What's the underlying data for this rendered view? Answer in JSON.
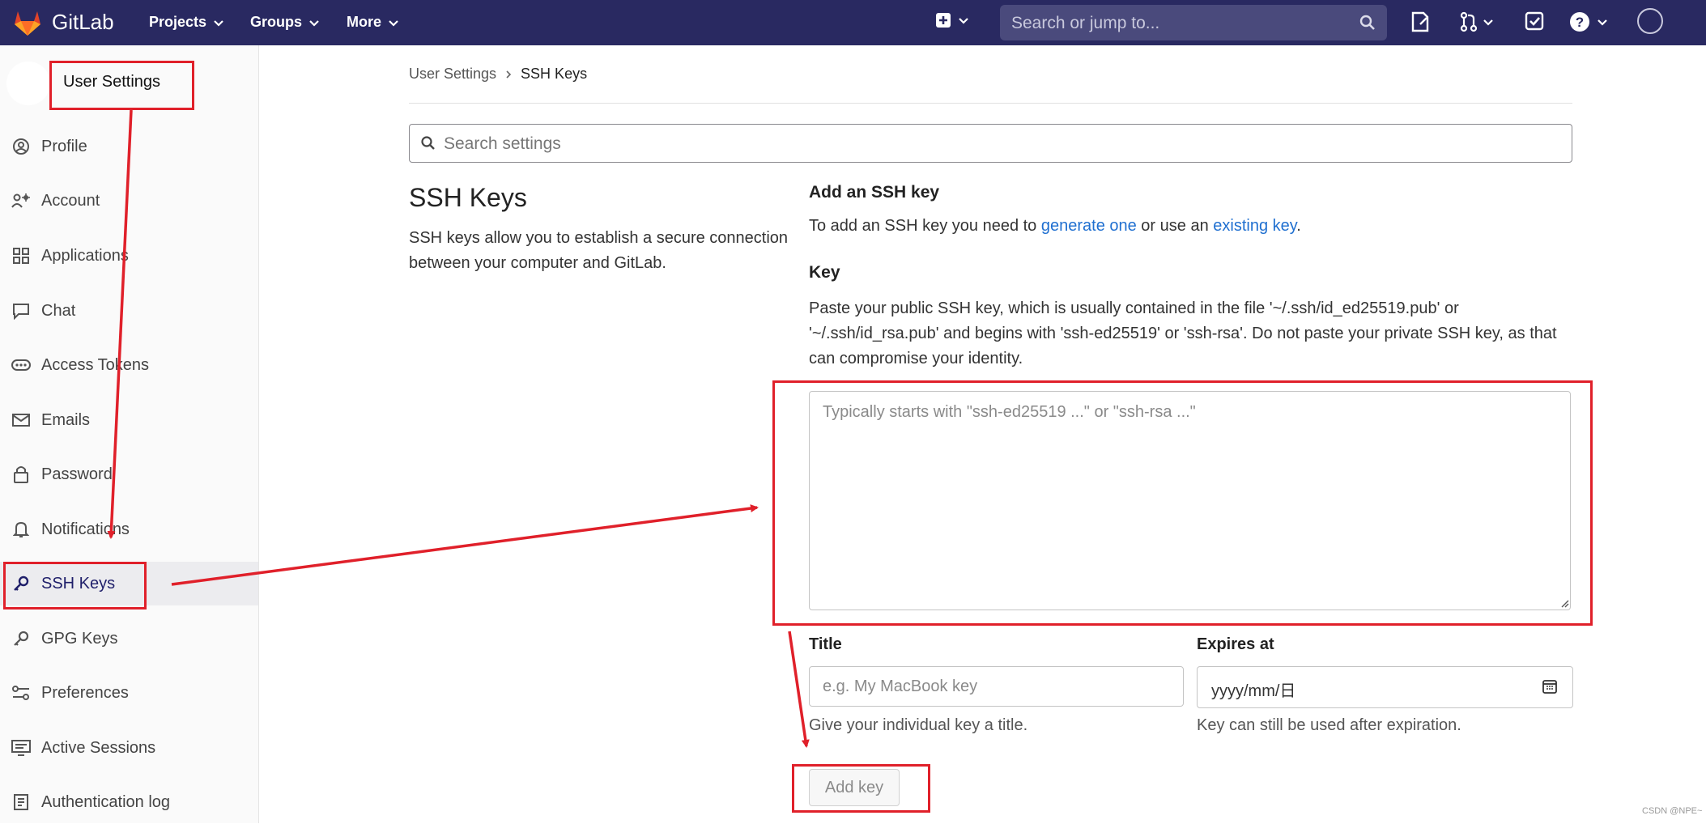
{
  "topbar": {
    "brand": "GitLab",
    "menus": [
      "Projects",
      "Groups",
      "More"
    ],
    "search_placeholder": "Search or jump to..."
  },
  "sidebar": {
    "title": "User Settings",
    "items": [
      {
        "label": "Profile",
        "icon": "profile-icon"
      },
      {
        "label": "Account",
        "icon": "account-icon"
      },
      {
        "label": "Applications",
        "icon": "applications-icon"
      },
      {
        "label": "Chat",
        "icon": "chat-icon"
      },
      {
        "label": "Access Tokens",
        "icon": "token-icon"
      },
      {
        "label": "Emails",
        "icon": "mail-icon"
      },
      {
        "label": "Password",
        "icon": "lock-icon"
      },
      {
        "label": "Notifications",
        "icon": "bell-icon"
      },
      {
        "label": "SSH Keys",
        "icon": "key-icon",
        "active": true
      },
      {
        "label": "GPG Keys",
        "icon": "key-icon"
      },
      {
        "label": "Preferences",
        "icon": "preferences-icon"
      },
      {
        "label": "Active Sessions",
        "icon": "monitor-icon"
      },
      {
        "label": "Authentication log",
        "icon": "log-icon"
      }
    ]
  },
  "breadcrumb": {
    "parent": "User Settings",
    "current": "SSH Keys"
  },
  "search_settings_placeholder": "Search settings",
  "section": {
    "title": "SSH Keys",
    "description": "SSH keys allow you to establish a secure connection between your computer and GitLab."
  },
  "add_key": {
    "heading": "Add an SSH key",
    "text_before": "To add an SSH key you need to ",
    "link1": "generate one",
    "text_middle": " or use an ",
    "link2": "existing key",
    "text_after": ".",
    "key_label": "Key",
    "key_help": "Paste your public SSH key, which is usually contained in the file '~/.ssh/id_ed25519.pub' or '~/.ssh/id_rsa.pub' and begins with 'ssh-ed25519' or 'ssh-rsa'. Do not paste your private SSH key, as that can compromise your identity.",
    "key_placeholder": "Typically starts with \"ssh-ed25519 ...\" or \"ssh-rsa ...\"",
    "title_label": "Title",
    "title_placeholder": "e.g. My MacBook key",
    "title_help": "Give your individual key a title.",
    "expires_label": "Expires at",
    "expires_value": "yyyy/mm/日",
    "expires_help": "Key can still be used after expiration.",
    "submit": "Add key"
  },
  "watermark": "CSDN @NPE~",
  "annotation_color": "#e0202a"
}
